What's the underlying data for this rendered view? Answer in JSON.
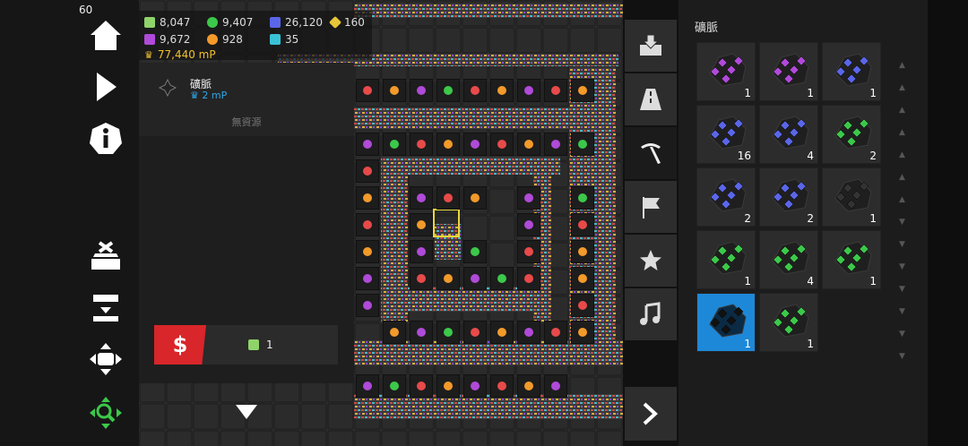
{
  "fps": "60",
  "resources": [
    {
      "icon": "credits-icon",
      "color": "#8fd36a",
      "value": "8,047"
    },
    {
      "icon": "green-ore-icon",
      "color": "#3cc84a",
      "value": "9,407"
    },
    {
      "icon": "blue-ore-icon",
      "color": "#5a66e8",
      "value": "26,120"
    },
    {
      "icon": "yellow-gem-icon",
      "color": "#e7c63a",
      "value": "160"
    },
    {
      "icon": "purple-ore-icon",
      "color": "#b04ad8",
      "value": "9,672"
    },
    {
      "icon": "orange-ore-icon",
      "color": "#f29a2a",
      "value": "928"
    },
    {
      "icon": "cyan-ore-icon",
      "color": "#39c2d6",
      "value": "35"
    }
  ],
  "power": "77,440 mP",
  "info_panel": {
    "title": "礦脈",
    "power": "2 mP",
    "status": "無資源"
  },
  "sell": {
    "count": "1"
  },
  "side_tabs": [
    "download-icon",
    "road-icon",
    "pickaxe-icon",
    "flag-icon",
    "star-icon",
    "music-icon"
  ],
  "right_panel": {
    "title": "礦脈",
    "items": [
      {
        "color": "#b04ad8",
        "count": "1"
      },
      {
        "color": "#b04ad8",
        "count": "1"
      },
      {
        "color": "#5a66e8",
        "count": "1"
      },
      {
        "color": "#5a66e8",
        "count": "16"
      },
      {
        "color": "#5a66e8",
        "count": "4"
      },
      {
        "color": "#3cc84a",
        "count": "2"
      },
      {
        "color": "#5a66e8",
        "count": "2"
      },
      {
        "color": "#5a66e8",
        "count": "2"
      },
      {
        "color": "#333333",
        "count": "1"
      },
      {
        "color": "#3cc84a",
        "count": "1"
      },
      {
        "color": "#3cc84a",
        "count": "4"
      },
      {
        "color": "#3cc84a",
        "count": "1"
      },
      {
        "color": "#111111",
        "count": "1"
      },
      {
        "color": "#3cc84a",
        "count": "1"
      }
    ]
  },
  "colors": {
    "accent_blue": "#1e88d8",
    "sell_red": "#d8262a",
    "power_yellow": "#f2c12e",
    "power_blue": "#2fa8e8"
  }
}
